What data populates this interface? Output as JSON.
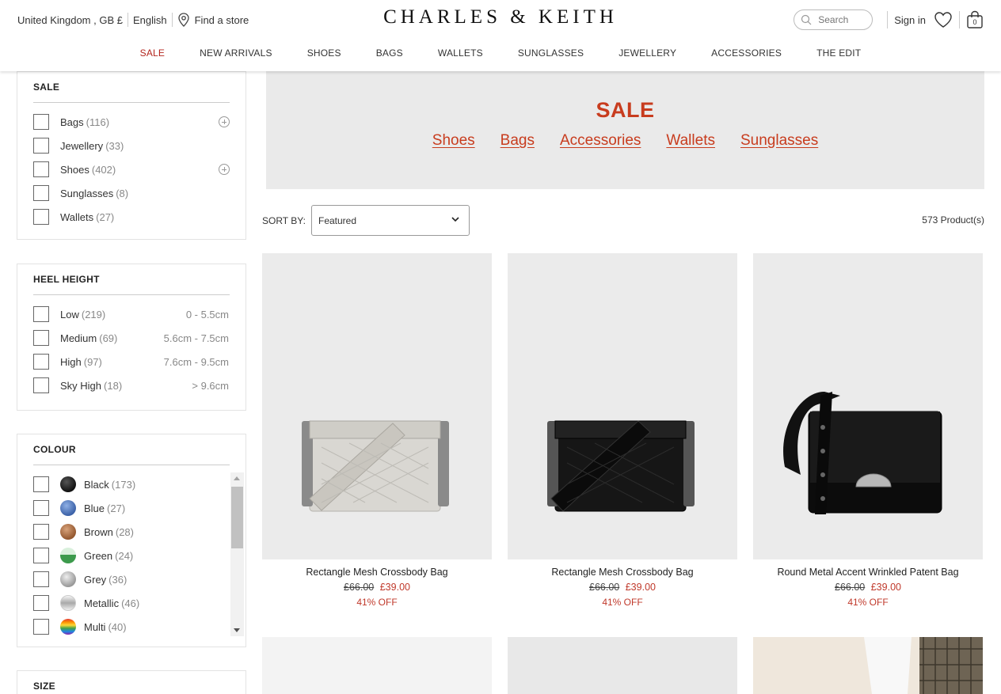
{
  "header": {
    "country": "United Kingdom , GB £",
    "language": "English",
    "find_store": "Find a store",
    "logo": "CHARLES & KEITH",
    "search_placeholder": "Search",
    "sign_in": "Sign in",
    "cart_count": "0"
  },
  "nav": [
    "SALE",
    "NEW ARRIVALS",
    "SHOES",
    "BAGS",
    "WALLETS",
    "SUNGLASSES",
    "JEWELLERY",
    "ACCESSORIES",
    "THE EDIT"
  ],
  "filters": {
    "sale": {
      "title": "SALE",
      "items": [
        {
          "label": "Bags",
          "count": "(116)"
        },
        {
          "label": "Jewellery",
          "count": "(33)"
        },
        {
          "label": "Shoes",
          "count": "(402)"
        },
        {
          "label": "Sunglasses",
          "count": "(8)"
        },
        {
          "label": "Wallets",
          "count": "(27)"
        }
      ]
    },
    "heel": {
      "title": "HEEL HEIGHT",
      "items": [
        {
          "label": "Low",
          "count": "(219)",
          "range": "0 - 5.5cm"
        },
        {
          "label": "Medium",
          "count": "(69)",
          "range": "5.6cm - 7.5cm"
        },
        {
          "label": "High",
          "count": "(97)",
          "range": "7.6cm - 9.5cm"
        },
        {
          "label": "Sky High",
          "count": "(18)",
          "range": "> 9.6cm"
        }
      ]
    },
    "colour": {
      "title": "COLOUR",
      "items": [
        {
          "label": "Black",
          "count": "(173)",
          "color": "#1a1a1a"
        },
        {
          "label": "Blue",
          "count": "(27)",
          "color": "#4a6fb0"
        },
        {
          "label": "Brown",
          "count": "(28)",
          "color": "#a0643c"
        },
        {
          "label": "Green",
          "count": "(24)",
          "color": "#3a9a4a"
        },
        {
          "label": "Grey",
          "count": "(36)",
          "color": "#a8a8a8"
        },
        {
          "label": "Metallic",
          "count": "(46)",
          "color": "#c8c8c8"
        },
        {
          "label": "Multi",
          "count": "(40)",
          "color": "#7a3ab0"
        }
      ]
    },
    "size": {
      "title": "SIZE"
    }
  },
  "banner": {
    "title": "SALE",
    "links": [
      "Shoes",
      "Bags",
      "Accessories",
      "Wallets",
      "Sunglasses"
    ]
  },
  "sort": {
    "label": "SORT BY:",
    "value": "Featured"
  },
  "product_count": "573 Product(s)",
  "products": [
    {
      "name": "Rectangle Mesh Crossbody Bag",
      "old_price": "£66.00",
      "new_price": "£39.00",
      "discount": "41% OFF",
      "bag_color": "#d9d7d2"
    },
    {
      "name": "Rectangle Mesh Crossbody Bag",
      "old_price": "£66.00",
      "new_price": "£39.00",
      "discount": "41% OFF",
      "bag_color": "#161616"
    },
    {
      "name": "Round Metal Accent Wrinkled Patent Bag",
      "old_price": "£66.00",
      "new_price": "£39.00",
      "discount": "41% OFF",
      "bag_color": "#0c0c0c"
    }
  ]
}
